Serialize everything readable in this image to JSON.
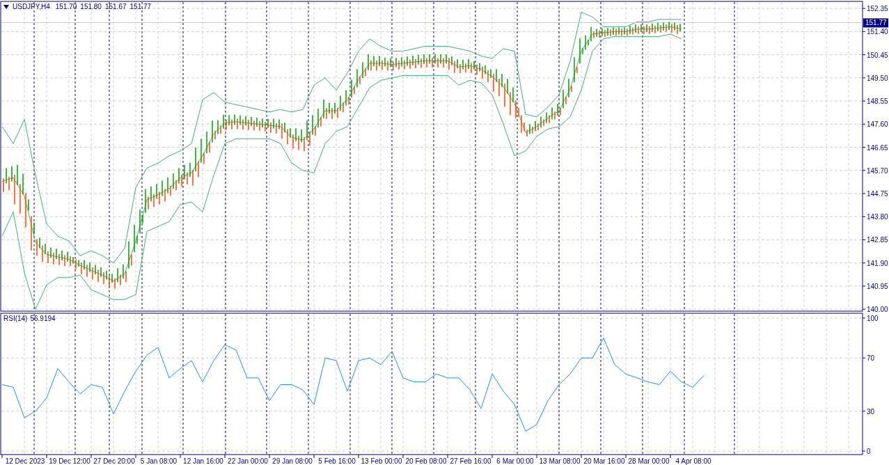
{
  "chart_window": {
    "symbol": "USDJPY,H4",
    "ohlc": [
      "151.70",
      "151.80",
      "151.67",
      "151.77"
    ],
    "current_price": "151.77",
    "price_pane": {
      "chart_data": {
        "type": "line",
        "grid": true,
        "ylim": [
          139.92,
          152.64
        ],
        "yticks": [
          {
            "value": 140,
            "label": "140.00"
          },
          {
            "value": 140.95,
            "label": "140.95"
          },
          {
            "value": 141.9,
            "label": "141.90"
          },
          {
            "value": 142.85,
            "label": "142.85"
          },
          {
            "value": 143.8,
            "label": "143.80"
          },
          {
            "value": 144.75,
            "label": "144.75"
          },
          {
            "value": 145.7,
            "label": "145.70"
          },
          {
            "value": 146.65,
            "label": "146.65"
          },
          {
            "value": 147.6,
            "label": "147.60"
          },
          {
            "value": 148.55,
            "label": "148.55"
          },
          {
            "value": 149.5,
            "label": "149.50"
          },
          {
            "value": 150.45,
            "label": "150.45"
          },
          {
            "value": 151.4,
            "label": "151.40"
          },
          {
            "value": 152.35,
            "label": "152.35"
          }
        ],
        "series": [
          {
            "color": "#3cb371",
            "values": [
              147.5,
              146.8,
              147.8,
              145.5,
              143.5,
              143.0,
              142.8,
              142.2,
              142.4,
              142.2,
              141.9,
              142.5,
              145.0,
              145.8,
              146.0,
              146.3,
              146.5,
              146.8,
              148.6,
              148.9,
              148.5,
              148.4,
              148.3,
              148.2,
              148.1,
              148.2,
              148.1,
              148.2,
              149.2,
              149.5,
              149.0,
              149.7,
              150.6,
              151.1,
              150.8,
              150.6,
              150.6,
              150.7,
              150.8,
              150.8,
              150.8,
              150.7,
              150.6,
              150.4,
              150.3,
              150.7,
              150.6,
              148.0,
              147.9,
              148.3,
              148.8,
              150.2,
              152.2,
              152.0,
              151.6,
              151.6,
              151.6,
              151.8,
              151.8,
              151.9,
              151.9,
              151.9
            ]
          },
          {
            "color": "#3cb371",
            "values": [
              145.25,
              145.4,
              144.65,
              142.75,
              142.25,
              142.15,
              142.05,
              141.8,
              141.6,
              141.4,
              141.15,
              141.45,
              142.8,
              144.5,
              144.7,
              144.95,
              145.4,
              145.6,
              146.3,
              147.2,
              147.65,
              147.7,
              147.65,
              147.6,
              147.55,
              147.5,
              147.05,
              146.95,
              147.4,
              148.15,
              148.15,
              148.6,
              149.45,
              150.1,
              150.1,
              150.05,
              150.1,
              150.15,
              150.2,
              150.2,
              150.2,
              149.95,
              150.0,
              149.85,
              149.55,
              149.15,
              148.45,
              147.25,
              147.5,
              147.85,
              148.15,
              149.05,
              150.6,
              151.3,
              151.35,
              151.4,
              151.4,
              151.5,
              151.5,
              151.55,
              151.6,
              151.5
            ]
          },
          {
            "color": "#3cb371",
            "values": [
              143.0,
              144.0,
              141.5,
              140.0,
              141.0,
              141.3,
              141.3,
              141.4,
              140.8,
              140.6,
              140.4,
              140.4,
              140.6,
              143.2,
              143.4,
              143.6,
              144.3,
              144.4,
              144.0,
              145.5,
              146.8,
              147.0,
              147.0,
              147.0,
              147.0,
              146.8,
              146.0,
              145.7,
              145.6,
              146.8,
              147.3,
              147.5,
              148.3,
              149.1,
              149.4,
              149.5,
              149.6,
              149.6,
              149.6,
              149.6,
              149.6,
              149.2,
              149.4,
              149.3,
              148.8,
              147.6,
              146.3,
              146.5,
              147.1,
              147.4,
              147.5,
              147.9,
              149.0,
              150.6,
              151.1,
              151.2,
              151.2,
              151.2,
              151.2,
              151.2,
              151.3,
              151.1
            ]
          }
        ]
      }
    },
    "rsi_pane": {
      "value": "56.9194",
      "chart_data": {
        "type": "line",
        "grid": true,
        "categories": [
          null,
          null,
          "12 Dec 2023",
          null,
          null,
          null,
          "19 Dec 12:00",
          null,
          null,
          null,
          "27 Dec 20:00",
          null,
          null,
          null,
          "5 Jan 08:00",
          null,
          null,
          null,
          "12 Jan 16:00",
          null,
          null,
          null,
          "22 Jan 00:00",
          null,
          null,
          null,
          "29 Jan 08:00",
          null,
          null,
          null,
          "5 Feb 16:00",
          null,
          null,
          null,
          "13 Feb 00:00",
          null,
          null,
          null,
          "20 Feb 08:00",
          null,
          null,
          null,
          "27 Feb 16:00",
          null,
          null,
          null,
          "6 Mar 00:00",
          null,
          null,
          null,
          "13 Mar 08:00",
          null,
          null,
          null,
          "20 Mar 16:00",
          null,
          null,
          null,
          "28 Mar 00:00",
          null,
          null,
          null,
          "4 Apr 08:00",
          null
        ],
        "ylim": [
          -2.6,
          103.6
        ],
        "yticks": [
          {
            "value": 0,
            "label": "0"
          },
          {
            "value": 30,
            "label": "30"
          },
          {
            "value": 70,
            "label": "70"
          },
          {
            "value": 100,
            "label": "100"
          }
        ],
        "series": [
          {
            "name": "RSI(14)",
            "color": "#1e90ff",
            "values": [
              50,
              48,
              25,
              30,
              40,
              62,
              52,
              43,
              50,
              48,
              28,
              45,
              60,
              72,
              78,
              55,
              62,
              68,
              52,
              68,
              80,
              76,
              55,
              55,
              38,
              50,
              50,
              46,
              35,
              70,
              68,
              45,
              68,
              70,
              65,
              75,
              55,
              52,
              52,
              58,
              55,
              55,
              46,
              32,
              58,
              45,
              35,
              15,
              20,
              38,
              50,
              58,
              70,
              70,
              85,
              65,
              58,
              55,
              52,
              50,
              60,
              52,
              48,
              56.9
            ]
          }
        ]
      }
    }
  }
}
